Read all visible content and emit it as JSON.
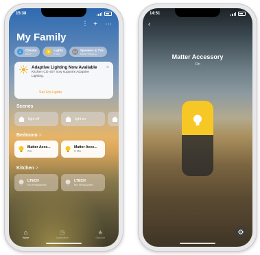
{
  "left_phone": {
    "status": {
      "time": "15:38"
    },
    "toolbar": {
      "waveform_glyph": "⫶",
      "add_glyph": "+",
      "more_glyph": "⋯"
    },
    "title": "My Family",
    "chips": [
      {
        "label": "Climate",
        "sub": "24.0°",
        "icon": "house-icon",
        "color": "#3a9be0"
      },
      {
        "label": "Lights",
        "sub": "2 On",
        "icon": "bulb-icon",
        "color": "#f7c825"
      },
      {
        "label": "Speakers & TVs",
        "sub": "None Playing",
        "icon": "tv-icon",
        "color": "#8e8e93"
      }
    ],
    "banner": {
      "title": "Adaptive Lighting Now Available",
      "body": "Kitchen CG-40T now supports Adaptive Lighting.",
      "close": "×",
      "link": "Set Up Lights"
    },
    "scenes": {
      "label": "Scenes",
      "items": [
        {
          "label": "light off"
        },
        {
          "label": "light on"
        },
        {
          "label": ""
        }
      ]
    },
    "bedroom": {
      "label": "Bedroom",
      "chevron": ">",
      "items": [
        {
          "name": "Matter Acce...",
          "status": "On"
        },
        {
          "name": "Matter Acce...",
          "status": "2 On"
        }
      ]
    },
    "kitchen": {
      "label": "Kitchen",
      "chevron": ">",
      "items": [
        {
          "name": "LTECH",
          "status": "No Response"
        },
        {
          "name": "LTECH",
          "status": "No Response"
        }
      ]
    },
    "tabs": [
      {
        "label": "Home",
        "glyph": "⌂",
        "active": true
      },
      {
        "label": "Automation",
        "glyph": "◷",
        "active": false
      },
      {
        "label": "Discover",
        "glyph": "★",
        "active": false
      }
    ]
  },
  "right_phone": {
    "status": {
      "time": "14:51"
    },
    "back_glyph": "‹",
    "accessory_name": "Matter Accessory",
    "accessory_status": "On",
    "brightness_fraction": 0.45,
    "gear_glyph": "⚙"
  },
  "colors": {
    "accent_orange": "#f09a1e",
    "bulb_yellow": "#f7c825"
  }
}
